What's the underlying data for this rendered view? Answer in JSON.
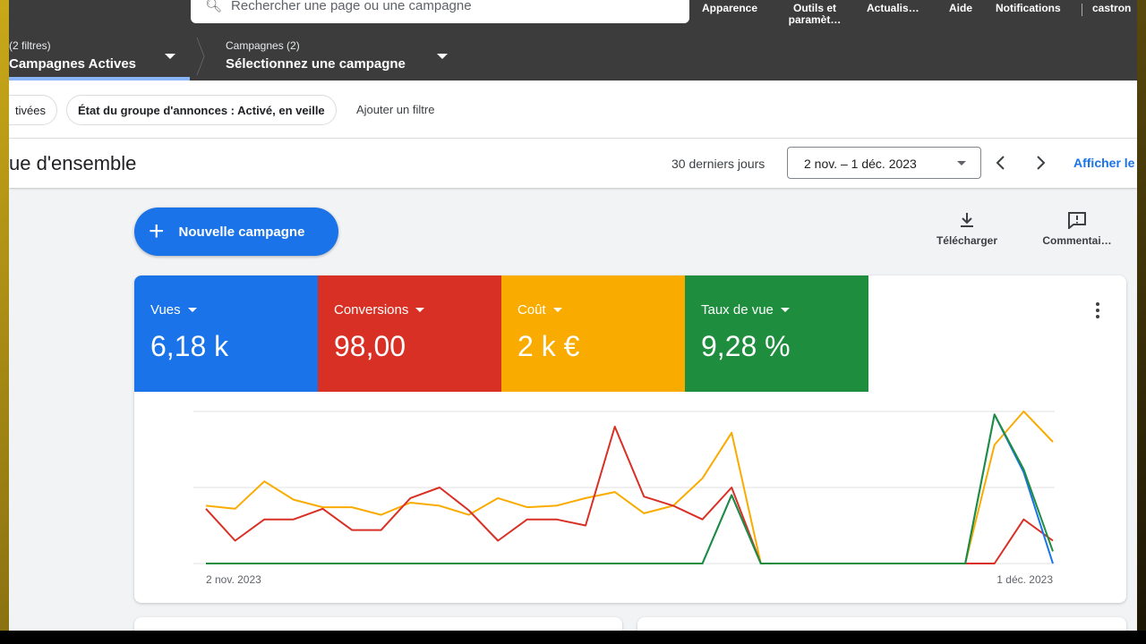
{
  "topbar": {
    "search_placeholder": "Rechercher une page ou une campagne",
    "items": [
      {
        "label": "Apparence"
      },
      {
        "label": "Outils et paramèt…"
      },
      {
        "label": "Actualis…"
      },
      {
        "label": "Aide"
      },
      {
        "label": "Notifications"
      },
      {
        "label": "castron"
      }
    ]
  },
  "breadcrumb": {
    "filters_small": "(2 filtres)",
    "filters_big": "Campagnes Actives",
    "campaigns_small": "Campagnes (2)",
    "campaigns_big": "Sélectionnez une campagne"
  },
  "filters": {
    "chip1": "tivées",
    "chip2": "État du groupe d'annonces : Activé, en veille",
    "add": "Ajouter un filtre"
  },
  "titlebar": {
    "title": "ue d'ensemble",
    "range_label": "30 derniers jours",
    "date_range": "2 nov. – 1 déc. 2023",
    "show_link": "Afficher le"
  },
  "actions": {
    "new_campaign": "Nouvelle campagne",
    "download": "Télécharger",
    "comments": "Commentai…"
  },
  "metrics": [
    {
      "label": "Vues",
      "value": "6,18 k",
      "color": "#1a73e8"
    },
    {
      "label": "Conversions",
      "value": "98,00",
      "color": "#d93025"
    },
    {
      "label": "Coût",
      "value": "2 k €",
      "color": "#f9ab00"
    },
    {
      "label": "Taux de vue",
      "value": "9,28 %",
      "color": "#1e8e3e"
    }
  ],
  "chart_data": {
    "type": "line",
    "x_start_label": "2 nov. 2023",
    "x_end_label": "1 déc. 2023",
    "ylim": [
      0,
      100
    ],
    "grid": true,
    "series": [
      {
        "color": "#f9ab00",
        "values": [
          38,
          36,
          54,
          42,
          37,
          37,
          32,
          40,
          38,
          32,
          43,
          37,
          38,
          43,
          47,
          33,
          38,
          56,
          86,
          0,
          0,
          0,
          0,
          0,
          0,
          0,
          0,
          78,
          100,
          80
        ]
      },
      {
        "color": "#d93025",
        "values": [
          36,
          15,
          29,
          29,
          36,
          22,
          22,
          43,
          50,
          35,
          15,
          29,
          29,
          25,
          90,
          44,
          38,
          29,
          50,
          0,
          0,
          0,
          0,
          0,
          0,
          0,
          0,
          0,
          29,
          15
        ]
      },
      {
        "color": "#1a73e8",
        "values": [
          0,
          0,
          0,
          0,
          0,
          0,
          0,
          0,
          0,
          0,
          0,
          0,
          0,
          0,
          0,
          0,
          0,
          0,
          45,
          0,
          0,
          0,
          0,
          0,
          0,
          0,
          0,
          98,
          60,
          0
        ]
      },
      {
        "color": "#1e8e3e",
        "values": [
          0,
          0,
          0,
          0,
          0,
          0,
          0,
          0,
          0,
          0,
          0,
          0,
          0,
          0,
          0,
          0,
          0,
          0,
          45,
          0,
          0,
          0,
          0,
          0,
          0,
          0,
          0,
          98,
          62,
          8
        ]
      }
    ]
  }
}
